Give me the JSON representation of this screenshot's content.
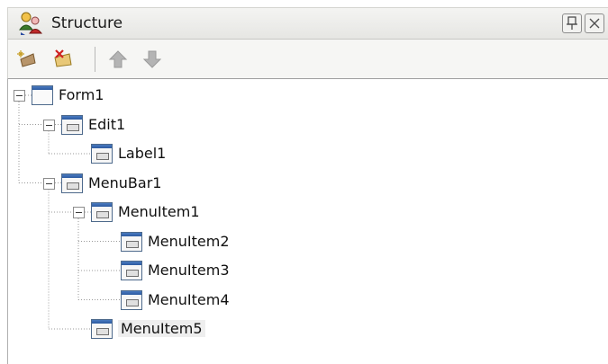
{
  "panel": {
    "title": "Structure",
    "title_icon": "structure-people-icon",
    "pin_icon": "pin-icon",
    "close_icon": "close-icon"
  },
  "toolbar": {
    "buttons": [
      {
        "name": "add-child-button",
        "icon": "new-node-icon"
      },
      {
        "name": "delete-button",
        "icon": "delete-node-icon"
      },
      {
        "name": "move-up-button",
        "icon": "arrow-up-icon"
      },
      {
        "name": "move-down-button",
        "icon": "arrow-down-icon"
      }
    ]
  },
  "tree": {
    "nodes": [
      {
        "label": "Form1",
        "depth": 0,
        "expanded": true
      },
      {
        "label": "Edit1",
        "depth": 1,
        "expanded": true
      },
      {
        "label": "Label1",
        "depth": 2
      },
      {
        "label": "MenuBar1",
        "depth": 1,
        "expanded": true
      },
      {
        "label": "MenuItem1",
        "depth": 2,
        "expanded": true
      },
      {
        "label": "MenuItem2",
        "depth": 3
      },
      {
        "label": "MenuItem3",
        "depth": 3
      },
      {
        "label": "MenuItem4",
        "depth": 3
      },
      {
        "label": "MenuItem5",
        "depth": 2,
        "selected": true
      }
    ]
  },
  "colors": {
    "line": "#9a9a9a",
    "arrow": "#a8a8a8"
  }
}
